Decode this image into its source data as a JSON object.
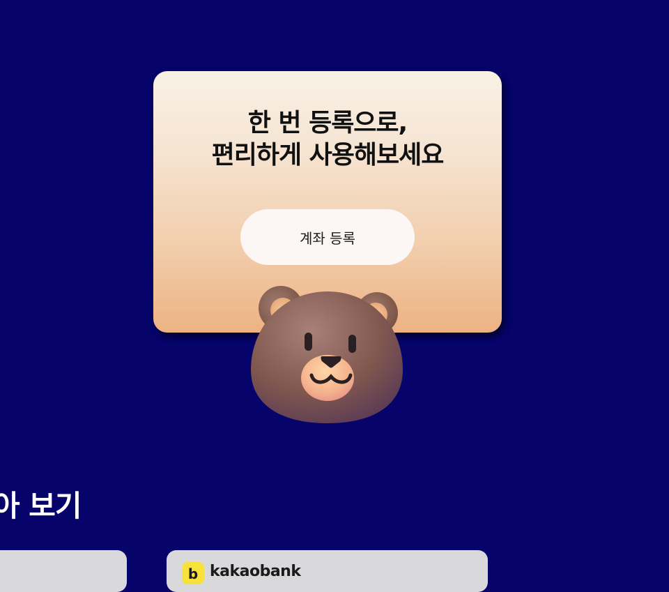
{
  "promo": {
    "title_line1": "한 번 등록으로,",
    "title_line2": "편리하게 사용해보세요",
    "button_label": "계좌 등록"
  },
  "section": {
    "title": "아 보기"
  },
  "bank_cards": [
    {
      "logo_letter": "",
      "name": ""
    },
    {
      "logo_letter": "b",
      "name": "kakaobank"
    }
  ],
  "colors": {
    "background": "#06036a",
    "card_top": "#f9f1e6",
    "card_bottom": "#edb283",
    "button": "#fcf7f4",
    "bank_card": "#d9d9db",
    "kakao_yellow": "#f7e23c"
  },
  "icons": {
    "mascot": "bear-mascot-icon",
    "bank_logo": "kakaobank-logo-icon"
  }
}
